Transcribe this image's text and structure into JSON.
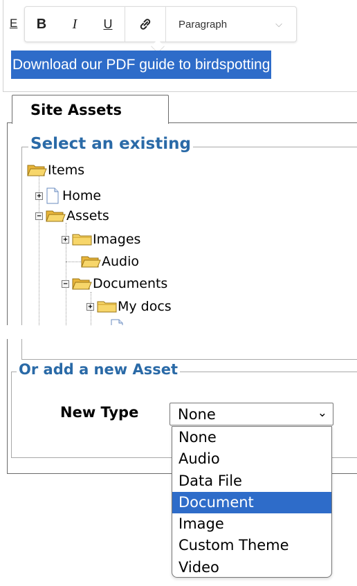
{
  "editor": {
    "leading_char": "E",
    "selected_text": "Download our PDF guide to birdspotting",
    "toolbar": {
      "bold_label": "B",
      "italic_label": "I",
      "underline_label": "U",
      "format_value": "Paragraph"
    }
  },
  "assets": {
    "tab_label": "Site Assets",
    "select_existing_legend": "Select an existing",
    "tree": [
      {
        "label": "Items",
        "icon": "folder-open-icon",
        "expander": ""
      },
      {
        "label": "Home",
        "icon": "document-icon",
        "expander": "+"
      },
      {
        "label": "Assets",
        "icon": "folder-open-icon",
        "expander": "−"
      },
      {
        "label": "Images",
        "icon": "folder-icon",
        "expander": "+"
      },
      {
        "label": "Audio",
        "icon": "folder-open-icon",
        "expander": ""
      },
      {
        "label": "Documents",
        "icon": "folder-open-icon",
        "expander": "−"
      },
      {
        "label": "My docs",
        "icon": "folder-icon",
        "expander": "+"
      }
    ],
    "add_new_legend": "Or add a new Asset",
    "new_type_label": "New Type",
    "new_type_value": "None",
    "new_type_options": [
      "None",
      "Audio",
      "Data File",
      "Document",
      "Image",
      "Custom Theme",
      "Video"
    ],
    "highlighted_option": "Document"
  },
  "colors": {
    "selection": "#2e6cc9",
    "legend": "#2a6aa7",
    "folder": "#f2c84b"
  }
}
